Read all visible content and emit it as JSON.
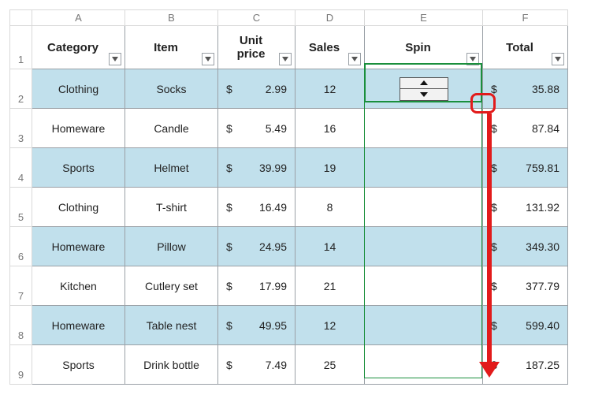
{
  "columns": {
    "A": "A",
    "B": "B",
    "C": "C",
    "D": "D",
    "E": "E",
    "F": "F"
  },
  "rows": {
    "r1": "1",
    "r2": "2",
    "r3": "3",
    "r4": "4",
    "r5": "5",
    "r6": "6",
    "r7": "7",
    "r8": "8",
    "r9": "9"
  },
  "headers": {
    "category": "Category",
    "item": "Item",
    "unit_price": "Unit price",
    "sales": "Sales",
    "spin": "Spin",
    "total": "Total"
  },
  "currency_symbol": "$",
  "data": [
    {
      "category": "Clothing",
      "item": "Socks",
      "unit_price": "2.99",
      "sales": "12",
      "total": "35.88"
    },
    {
      "category": "Homeware",
      "item": "Candle",
      "unit_price": "5.49",
      "sales": "16",
      "total": "87.84"
    },
    {
      "category": "Sports",
      "item": "Helmet",
      "unit_price": "39.99",
      "sales": "19",
      "total": "759.81"
    },
    {
      "category": "Clothing",
      "item": "T-shirt",
      "unit_price": "16.49",
      "sales": "8",
      "total": "131.92"
    },
    {
      "category": "Homeware",
      "item": "Pillow",
      "unit_price": "24.95",
      "sales": "14",
      "total": "349.30"
    },
    {
      "category": "Kitchen",
      "item": "Cutlery set",
      "unit_price": "17.99",
      "sales": "21",
      "total": "377.79"
    },
    {
      "category": "Homeware",
      "item": "Table nest",
      "unit_price": "49.95",
      "sales": "12",
      "total": "599.40"
    },
    {
      "category": "Sports",
      "item": "Drink bottle",
      "unit_price": "7.49",
      "sales": "25",
      "total": "187.25"
    }
  ],
  "selection": {
    "range": "E2:E9"
  },
  "annotations": {
    "fill_handle_highlight": true,
    "drag_arrow_down": true
  }
}
